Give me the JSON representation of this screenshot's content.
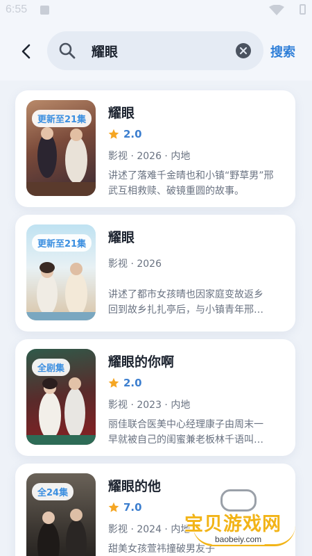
{
  "status": {
    "time": "6:55"
  },
  "search": {
    "value": "耀眼",
    "submit_label": "搜索"
  },
  "results": [
    {
      "title": "耀眼",
      "badge": "更新至21集",
      "rating": "2.0",
      "meta": "影视 · 2026 · 内地",
      "desc": [
        "讲述了落难千金晴也和小镇“野草男”邢",
        "武互相救赎、破镜重圆的故事。"
      ]
    },
    {
      "title": "耀眼",
      "badge": "更新至21集",
      "rating": "",
      "meta": "影视 · 2026",
      "desc": [
        "讲述了都市女孩晴也因家庭变故返乡",
        "回到故乡扎扎亭后，与小镇青年邢…"
      ]
    },
    {
      "title": "耀眼的你啊",
      "badge": "全剧集",
      "rating": "2.0",
      "meta": "影视 · 2023 · 内地",
      "desc": [
        "丽佳联合医美中心经理康子由周末一",
        "早就被自己的闺蜜兼老板林千语叫…"
      ]
    },
    {
      "title": "耀眼的他",
      "badge": "全24集",
      "rating": "7.0",
      "meta": "影视 · 2024 · 内地",
      "desc": [
        "甜美女孩萱祎撞破男友子"
      ]
    }
  ],
  "watermark": {
    "text": "宝贝游戏网",
    "url": "baobeiy.com"
  },
  "colors": {
    "accent": "#2f7fd8",
    "star": "#f5a623",
    "badge_text": "#3b8fe0",
    "watermark": "#f2b418"
  }
}
